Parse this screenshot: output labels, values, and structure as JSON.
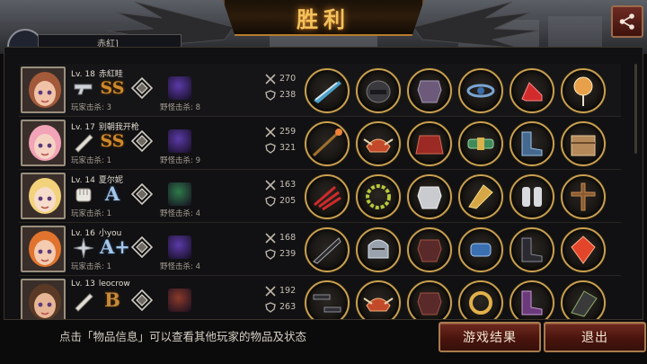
{
  "title": "胜利",
  "top_player": {
    "name": "赤紅] "
  },
  "players": [
    {
      "level": "Lv. 18",
      "name": "赤紅眭",
      "rank": "SS",
      "rank_class": "ss",
      "player_kills": "玩家击杀: 3",
      "monster_kills": "野怪击杀: 8",
      "attack": "270",
      "defense": "238",
      "weapon_icon": "pistol-icon",
      "monster_color": "#5b3aa8",
      "hair": "#a35a3a",
      "skin": "#f0c3a8",
      "items": [
        "rifle-icon",
        "dark-helmet-icon",
        "armor-icon",
        "amulet-icon",
        "red-heels-icon",
        "lollipop-icon"
      ]
    },
    {
      "level": "Lv. 17",
      "name": "别朝我开枪",
      "rank": "SS",
      "rank_class": "ss",
      "player_kills": "玩家击杀: 1",
      "monster_kills": "野怪击杀: 9",
      "attack": "259",
      "defense": "321",
      "weapon_icon": "bat-icon",
      "monster_color": "#5b3aa8",
      "hair": "#f2a3b8",
      "skin": "#f5d3c3",
      "items": [
        "flame-staff-icon",
        "winged-helmet-icon",
        "red-cape-icon",
        "green-belt-icon",
        "boots-icon",
        "treasure-box-icon"
      ]
    },
    {
      "level": "Lv. 14",
      "name": "夏尔妮",
      "rank": "A",
      "rank_class": "a",
      "player_kills": "玩家击杀: 1",
      "monster_kills": "野怪击杀: 4",
      "attack": "163",
      "defense": "205",
      "weapon_icon": "fist-icon",
      "monster_color": "#2f7a4a",
      "hair": "#f2d27a",
      "skin": "#f6dccb",
      "items": [
        "red-claw-icon",
        "laurel-wreath-icon",
        "silver-armor-icon",
        "gold-wing-icon",
        "gauntlets-icon",
        "cross-icon"
      ]
    },
    {
      "level": "Lv. 16",
      "name": "小you",
      "rank": "A+",
      "rank_class": "a",
      "player_kills": "玩家击杀: 1",
      "monster_kills": "野怪击杀: 4",
      "attack": "168",
      "defense": "239",
      "weapon_icon": "shuriken-icon",
      "monster_color": "#5b3aa8",
      "hair": "#e0742e",
      "skin": "#f3cbb0",
      "items": [
        "black-blade-icon",
        "knight-helmet-icon",
        "dark-armor-icon",
        "blue-bracer-icon",
        "black-boots-icon",
        "red-gem-icon"
      ]
    },
    {
      "level": "Lv. 13",
      "name": "leocrow",
      "rank": "B",
      "rank_class": "b",
      "player_kills": "",
      "monster_kills": "",
      "attack": "192",
      "defense": "263",
      "weapon_icon": "bat-icon",
      "monster_color": "#8a3a2a",
      "hair": "#5a3a26",
      "skin": "#e6b595",
      "items": [
        "nunchaku-icon",
        "winged-helmet-icon",
        "dark-armor-icon",
        "gold-ring-icon",
        "purple-boots-icon",
        "talisman-icon"
      ]
    }
  ],
  "footer": {
    "hint": "点击「物品信息」可以查看其他玩家的物品及状态",
    "result_button": "游戏结果",
    "exit_button": "退出"
  },
  "colors": {
    "accent_gold": "#c9a050",
    "button_red": "#4a140d",
    "title_glow": "#f4c25c"
  }
}
